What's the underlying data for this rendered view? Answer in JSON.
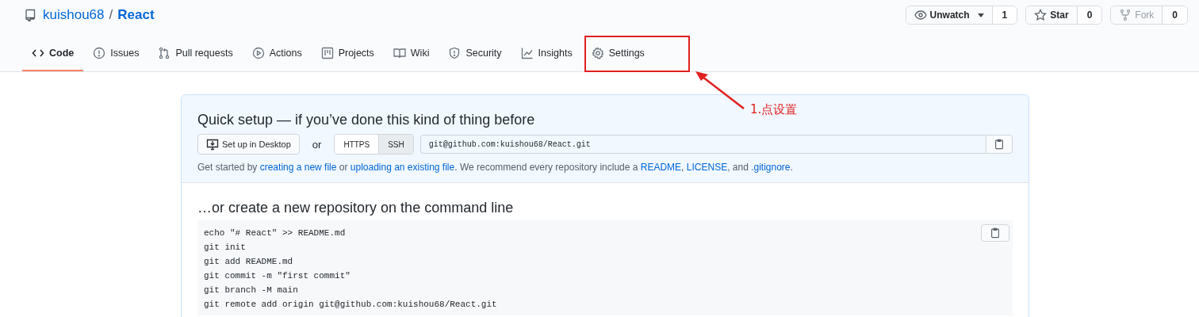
{
  "repo": {
    "owner": "kuishou68",
    "separator": "/",
    "name": "React"
  },
  "actions": [
    {
      "kind": "watch",
      "label": "Unwatch",
      "count": "1",
      "disabled": false
    },
    {
      "kind": "star",
      "label": "Star",
      "count": "0",
      "disabled": false
    },
    {
      "kind": "fork",
      "label": "Fork",
      "count": "0",
      "disabled": true
    }
  ],
  "tabs": [
    {
      "label": "Code",
      "selected": true
    },
    {
      "label": "Issues",
      "selected": false
    },
    {
      "label": "Pull requests",
      "selected": false
    },
    {
      "label": "Actions",
      "selected": false
    },
    {
      "label": "Projects",
      "selected": false
    },
    {
      "label": "Wiki",
      "selected": false
    },
    {
      "label": "Security",
      "selected": false
    },
    {
      "label": "Insights",
      "selected": false
    },
    {
      "label": "Settings",
      "selected": false
    }
  ],
  "annotation": {
    "label": "1.点设置"
  },
  "quick_setup": {
    "title": "Quick setup — if you’ve done this kind of thing before",
    "desktop_button": "Set up in Desktop",
    "or_text": "or",
    "protocols": [
      {
        "label": "HTTPS",
        "selected": false
      },
      {
        "label": "SSH",
        "selected": true
      }
    ],
    "clone_url": "git@github.com:kuishou68/React.git",
    "hint": [
      {
        "text": "Get started by ",
        "link": false
      },
      {
        "text": "creating a new file",
        "link": true
      },
      {
        "text": " or ",
        "link": false
      },
      {
        "text": "uploading an existing file",
        "link": true
      },
      {
        "text": ". We recommend every repository include a ",
        "link": false
      },
      {
        "text": "README",
        "link": true
      },
      {
        "text": ", ",
        "link": false
      },
      {
        "text": "LICENSE",
        "link": true
      },
      {
        "text": ", and ",
        "link": false
      },
      {
        "text": ".gitignore",
        "link": true
      },
      {
        "text": ".",
        "link": false
      }
    ]
  },
  "command_line": {
    "title": "…or create a new repository on the command line",
    "lines": [
      "echo \"# React\" >> README.md",
      "git init",
      "git add README.md",
      "git commit -m \"first commit\"",
      "git branch -M main",
      "git remote add origin git@github.com:kuishou68/React.git"
    ]
  }
}
